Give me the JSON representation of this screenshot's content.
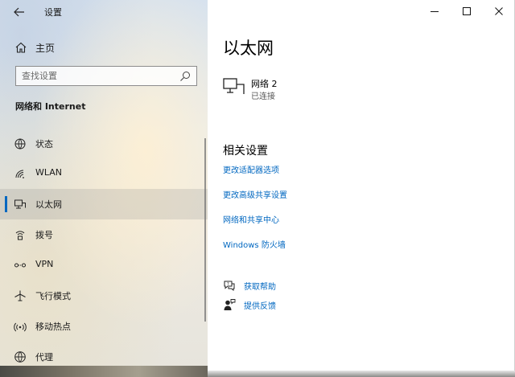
{
  "app": {
    "title": "设置"
  },
  "sidebar": {
    "home_label": "主页",
    "search_placeholder": "查找设置",
    "section_title": "网络和 Internet",
    "items": [
      {
        "label": "状态",
        "icon": "globe-status-icon",
        "selected": false
      },
      {
        "label": "WLAN",
        "icon": "wifi-icon",
        "selected": false
      },
      {
        "label": "以太网",
        "icon": "ethernet-icon",
        "selected": true
      },
      {
        "label": "拨号",
        "icon": "dialup-icon",
        "selected": false
      },
      {
        "label": "VPN",
        "icon": "vpn-icon",
        "selected": false
      },
      {
        "label": "飞行模式",
        "icon": "airplane-icon",
        "selected": false
      },
      {
        "label": "移动热点",
        "icon": "hotspot-icon",
        "selected": false
      },
      {
        "label": "代理",
        "icon": "proxy-globe-icon",
        "selected": false
      }
    ]
  },
  "main": {
    "title": "以太网",
    "network": {
      "name": "网络 2",
      "status": "已连接"
    },
    "related_title": "相关设置",
    "related_links": [
      "更改适配器选项",
      "更改高级共享设置",
      "网络和共享中心",
      "Windows 防火墙"
    ],
    "help_links": [
      {
        "label": "获取帮助",
        "icon": "help-chat-icon"
      },
      {
        "label": "提供反馈",
        "icon": "feedback-icon"
      }
    ]
  },
  "colors": {
    "accent": "#0067c0",
    "link": "#0067c0",
    "text": "#1a1a1a"
  }
}
